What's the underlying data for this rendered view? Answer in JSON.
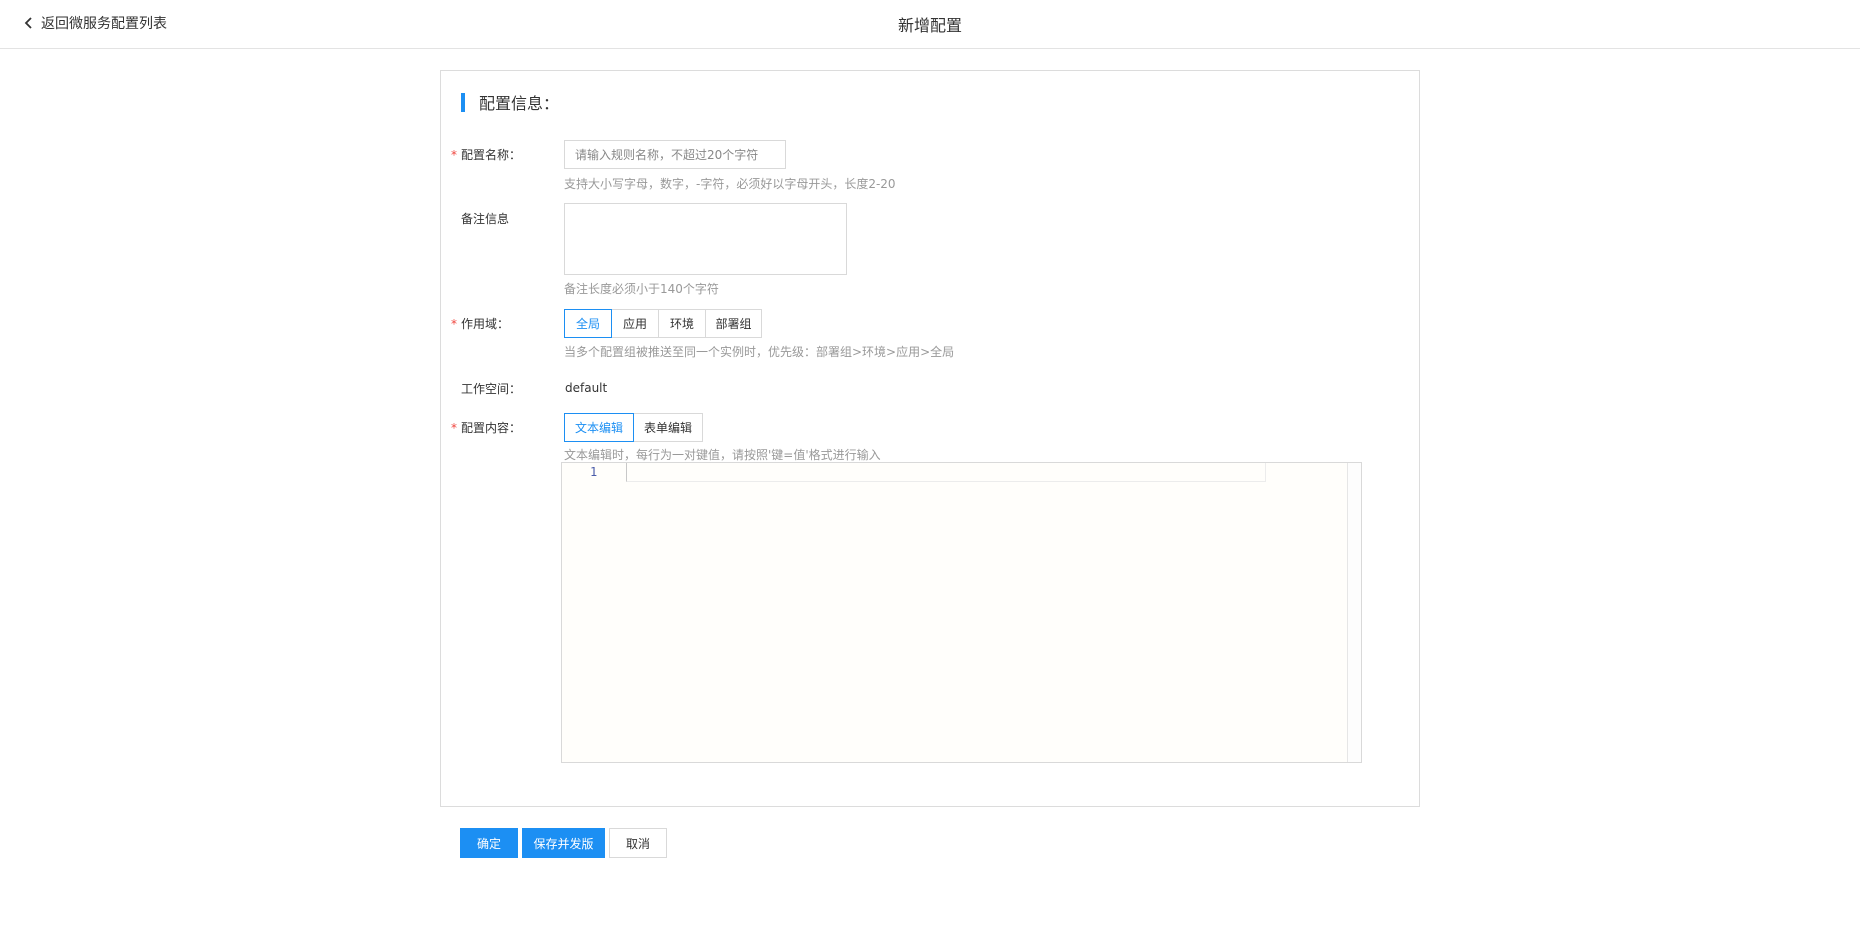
{
  "header": {
    "back_label": "返回微服务配置列表",
    "title": "新增配置"
  },
  "section": {
    "title": "配置信息："
  },
  "form": {
    "required_mark": "*",
    "name": {
      "label": "配置名称：",
      "placeholder": "请输入规则名称，不超过20个字符",
      "hint": "支持大小写字母，数字，-字符，必须好以字母开头，长度2-20"
    },
    "remark": {
      "label": "备注信息",
      "value": "",
      "hint": "备注长度必须小于140个字符"
    },
    "scope": {
      "label": "作用域：",
      "options": [
        "全局",
        "应用",
        "环境",
        "部署组"
      ],
      "selected": "全局",
      "hint": "当多个配置组被推送至同一个实例时，优先级：部署组>环境>应用>全局"
    },
    "workspace": {
      "label": "工作空间：",
      "value": "default"
    },
    "content": {
      "label": "配置内容：",
      "modes": [
        "文本编辑",
        "表单编辑"
      ],
      "selected": "文本编辑",
      "hint": "文本编辑时，每行为一对键值，请按照'键=值'格式进行输入",
      "editor": {
        "line_numbers": [
          "1"
        ],
        "text": ""
      }
    }
  },
  "actions": {
    "confirm": "确定",
    "save_publish": "保存并发版",
    "cancel": "取消"
  },
  "colors": {
    "primary": "#1c8ff3",
    "required": "#f0463f",
    "hint": "#999999"
  },
  "icons": {
    "back": "chevron-left-icon"
  }
}
